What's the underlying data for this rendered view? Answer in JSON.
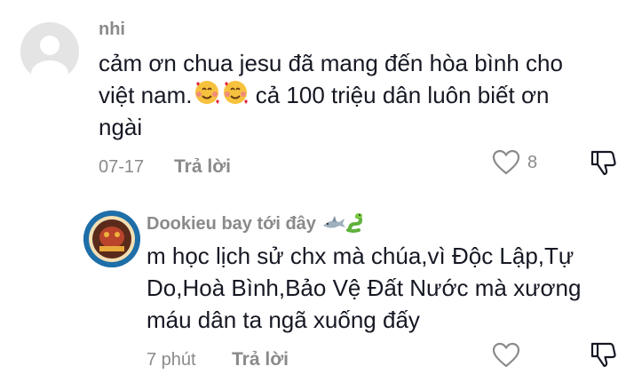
{
  "comment": {
    "username": "nhi",
    "text_line1": "cảm ơn chua jesu đã mang đến hòa bình cho",
    "text_line2_a": "việt nam.",
    "text_line2_b": " cả 100 triệu dân luôn biết ơn",
    "text_line3": "ngài",
    "emojis": [
      "smiling-face-with-hearts",
      "smiling-face-with-hearts"
    ],
    "date": "07-17",
    "reply_label": "Trả lời",
    "like_count": "8"
  },
  "reply": {
    "username": "Dookieu bay tới đây",
    "username_emojis": [
      "shark",
      "snake"
    ],
    "text_line1": "m học lịch sử chx mà chúa,vì Độc Lập,Tự",
    "text_line2": "Do,Hoà Bình,Bảo Vệ Đất Nước mà xương",
    "text_line3": "máu dân ta ngã xuống đấy",
    "time": "7 phút",
    "reply_label": "Trả lời"
  },
  "colors": {
    "text": "#161823",
    "muted": "#8a8a8a",
    "avatar_bg": "#e4e4e4"
  }
}
